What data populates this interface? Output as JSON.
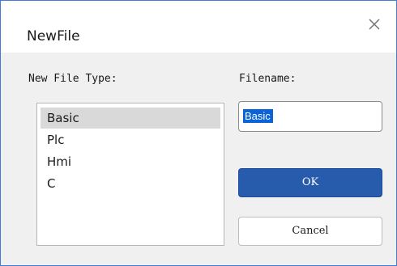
{
  "window": {
    "title": "NewFile",
    "close_icon": "close-icon"
  },
  "file_type": {
    "label": "New File Type:",
    "items": [
      "Basic",
      "Plc",
      "Hmi",
      "C"
    ],
    "selected": "Basic"
  },
  "filename": {
    "label": "Filename:",
    "value": "Basic"
  },
  "buttons": {
    "ok_label": "OK",
    "cancel_label": "Cancel"
  },
  "colors": {
    "accent": "#275bab",
    "selection": "#0a64d7",
    "window_border": "#3b7dd8",
    "list_selected": "#d9d9d9"
  }
}
